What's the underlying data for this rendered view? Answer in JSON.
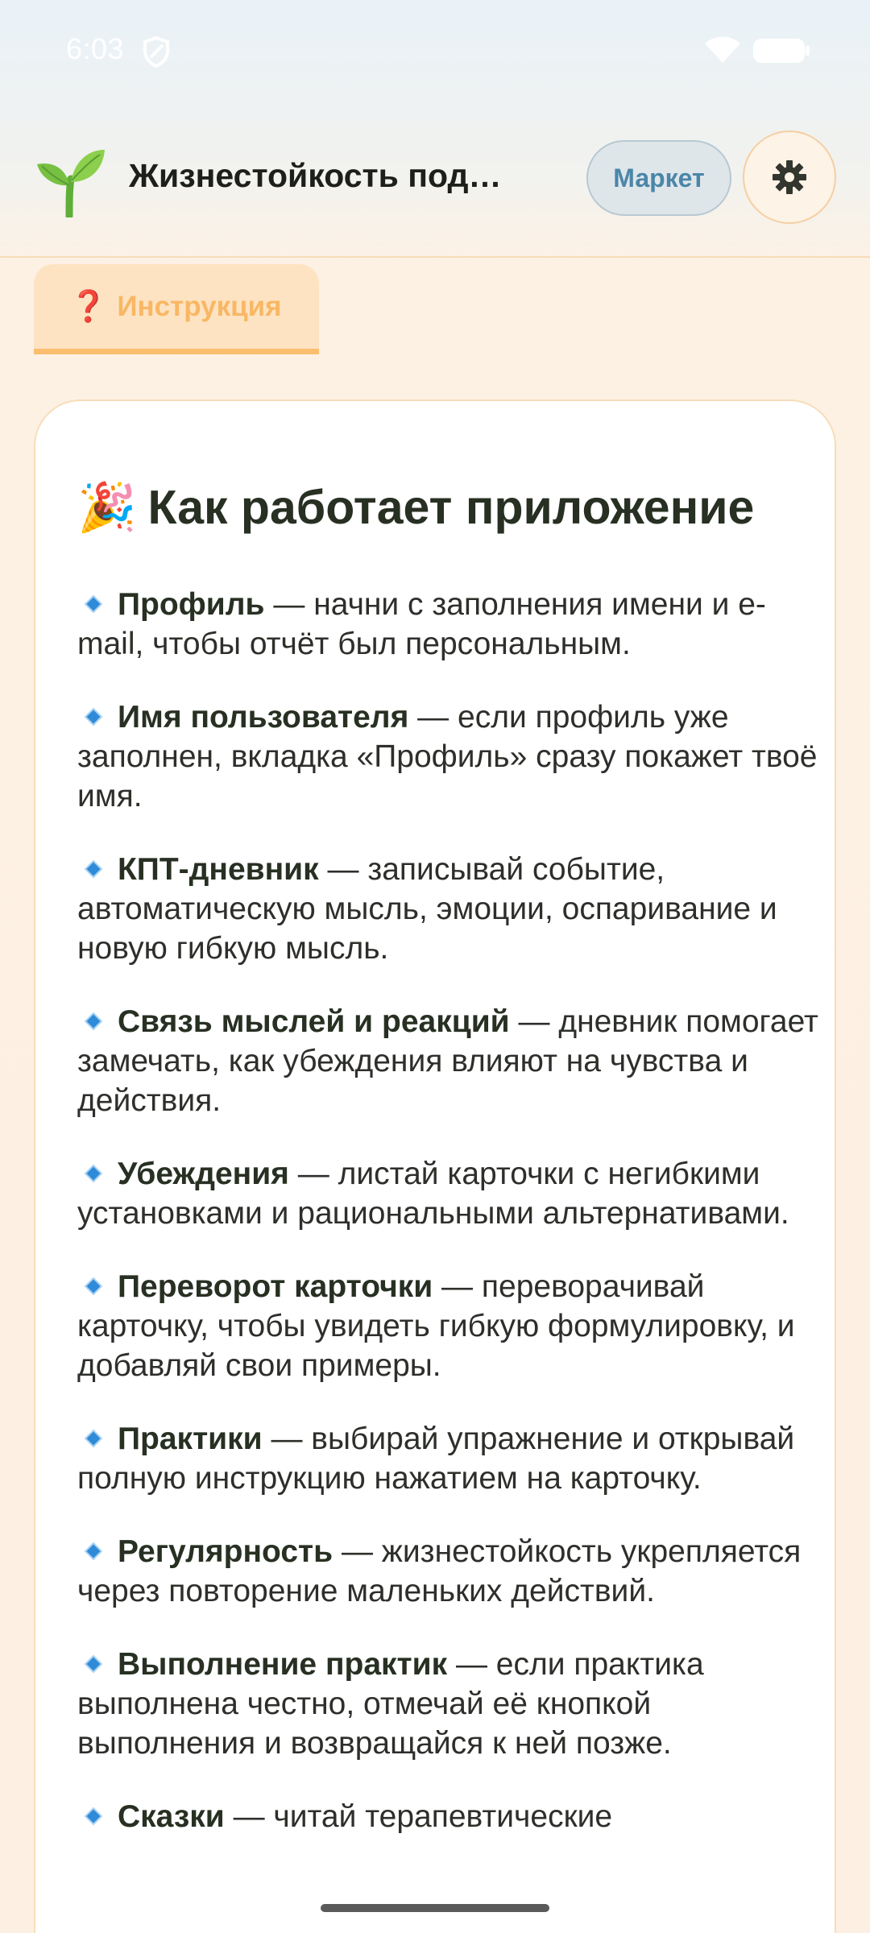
{
  "status_bar": {
    "time": "6:03",
    "icons": [
      "shield-icon",
      "wifi-icon",
      "battery-icon"
    ]
  },
  "header": {
    "logo_icon": "seedling-icon",
    "title": "Жизнестойкость подростка",
    "market_label": "Маркет",
    "settings_icon": "gear-icon"
  },
  "tabs": [
    {
      "icon": "❓",
      "label": "Инструкция",
      "active": true
    }
  ],
  "card": {
    "title_emoji": "🎉",
    "title": "Как работает приложение",
    "items": [
      {
        "term": "Профиль",
        "text": " — начни с заполнения имени и e-mail, чтобы отчёт был персональным."
      },
      {
        "term": "Имя пользователя",
        "text": " — если профиль уже заполнен, вкладка «Профиль» сразу покажет твоё имя."
      },
      {
        "term": "КПТ-дневник",
        "text": " — записывай событие, автоматическую мысль, эмоции, оспаривание и новую гибкую мысль."
      },
      {
        "term": "Связь мыслей и реакций",
        "text": " — дневник помогает замечать, как убеждения влияют на чувства и действия."
      },
      {
        "term": "Убеждения",
        "text": " — листай карточки с негибкими установками и рациональными альтернативами."
      },
      {
        "term": "Переворот карточки",
        "text": " — переворачивай карточку, чтобы увидеть гибкую формулировку, и добавляй свои примеры."
      },
      {
        "term": "Практики",
        "text": " — выбирай упражнение и открывай полную инструкцию нажатием на карточку."
      },
      {
        "term": "Регулярность",
        "text": " — жизнестойкость укрепляется через повторение маленьких действий."
      },
      {
        "term": "Выполнение практик",
        "text": " — если практика выполнена честно, отмечай её кнопкой выполнения и возвращайся к ней позже."
      },
      {
        "term": "Сказки",
        "text": " — читай терапевтические"
      }
    ]
  },
  "colors": {
    "accent": "#fbbe6e",
    "tab_bg": "#fde3c2",
    "market": "#4a86a8",
    "bullet": "#2f8bd8",
    "title": "#273022"
  }
}
